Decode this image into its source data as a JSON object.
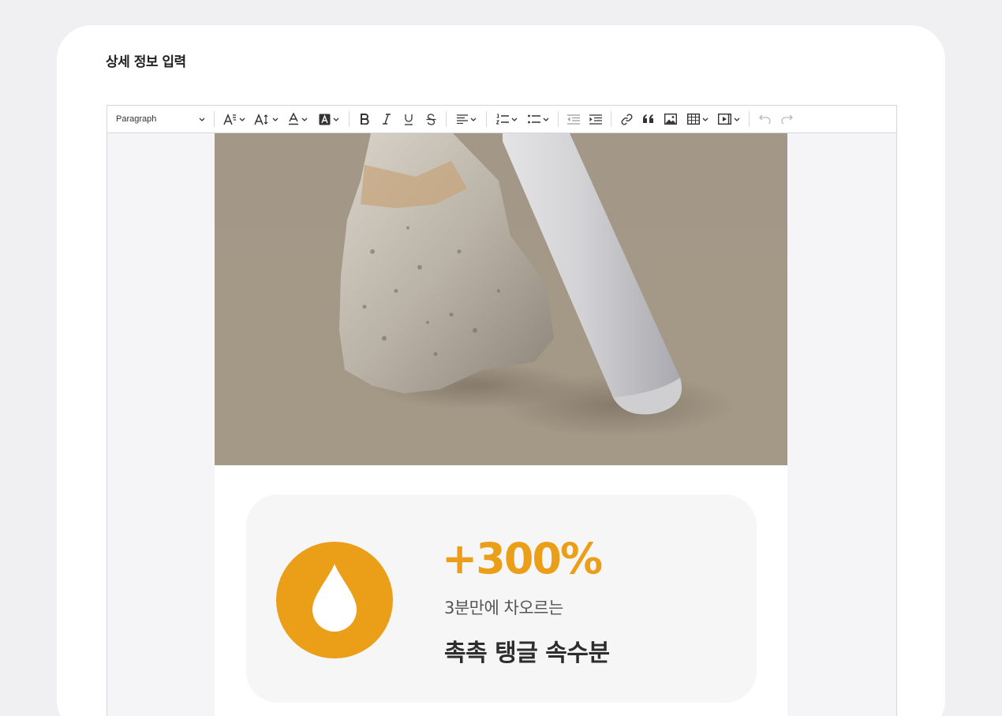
{
  "section": {
    "title": "상세 정보 입력"
  },
  "toolbar": {
    "heading_select": "Paragraph",
    "buttons": [
      "font-family",
      "font-size",
      "font-color",
      "background-color",
      "bold",
      "italic",
      "underline",
      "strikethrough",
      "alignment",
      "numbered-list",
      "bulleted-list",
      "outdent",
      "indent",
      "link",
      "blockquote",
      "insert-image",
      "insert-table",
      "insert-media",
      "undo",
      "redo"
    ]
  },
  "content": {
    "image": {
      "description_icon": "stone-and-white-tube-product-photo"
    },
    "highlight": {
      "icon": "water-drop-icon",
      "value": "+300%",
      "subtitle": "3분만에 차오르는",
      "title": "촉촉 탱글 속수분"
    }
  },
  "colors": {
    "accent": "#eb9e18",
    "photo_background": "#a3988a",
    "page_background": "#f0f0f2"
  }
}
